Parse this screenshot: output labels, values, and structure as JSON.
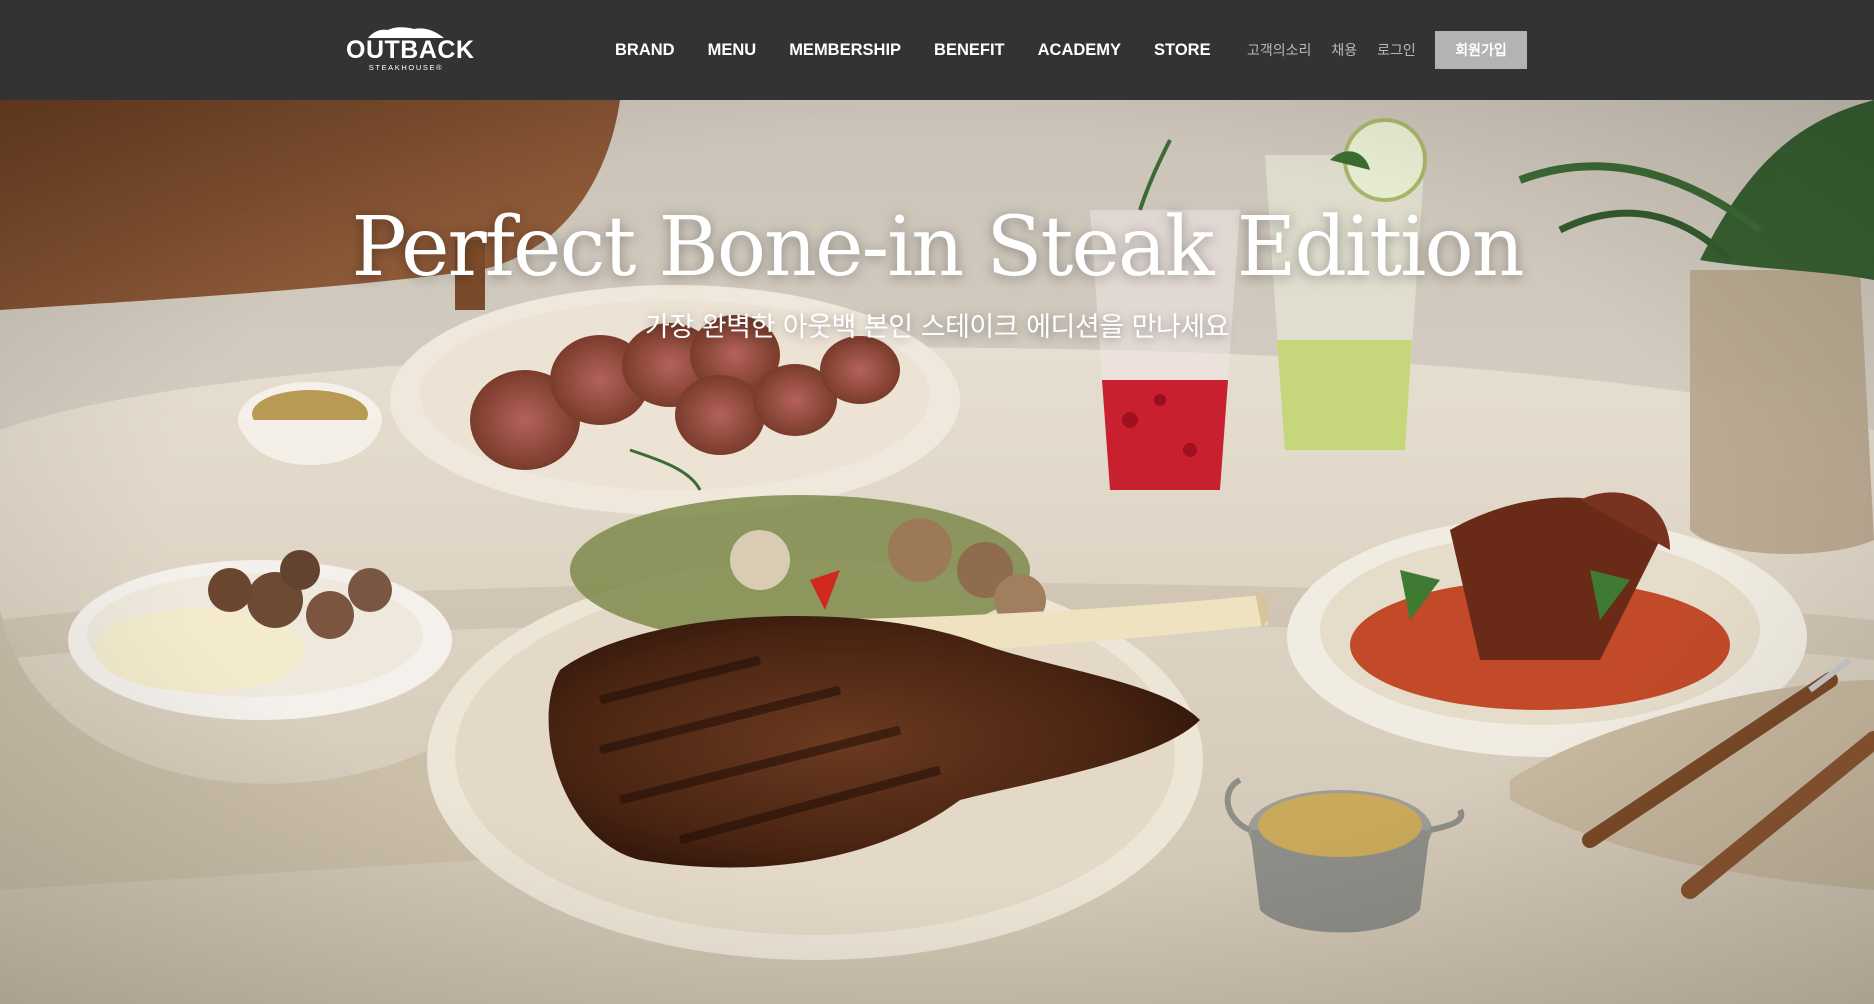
{
  "header": {
    "logo": {
      "name": "OUTBACK",
      "sub": "STEAKHOUSE®"
    },
    "nav": [
      {
        "label": "BRAND"
      },
      {
        "label": "MENU"
      },
      {
        "label": "MEMBERSHIP"
      },
      {
        "label": "BENEFIT"
      },
      {
        "label": "ACADEMY"
      },
      {
        "label": "STORE"
      }
    ],
    "utility": [
      {
        "label": "고객의소리"
      },
      {
        "label": "채용"
      },
      {
        "label": "로그인"
      }
    ],
    "join_label": "회원가입"
  },
  "hero": {
    "title": "Perfect Bone-in Steak Edition",
    "subtitle": "가장 완벽한 아웃백 본인 스테이크 에디션을 만나세요",
    "image_description": "tomahawk steak with side dishes and drinks on linen table"
  },
  "colors": {
    "header_bg": "#333333",
    "join_bg": "#b3b3b3",
    "tablecloth": "#d8cfc0"
  }
}
